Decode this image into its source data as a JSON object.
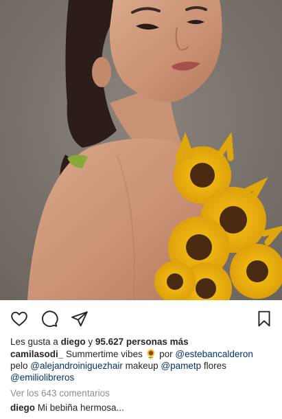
{
  "post": {
    "image_alt": "portrait with sunflowers",
    "likes": {
      "prefix": "Les gusta a ",
      "user": "diego",
      "middle": " y ",
      "count": "95.627 personas más"
    },
    "caption": {
      "username": "camilasodi_",
      "text_1": " Summertime vibes ",
      "emoji": "🌻",
      "text_2": " por ",
      "mention_1": "@estebancalderon",
      "text_3": "pelo ",
      "mention_2": "@alejandroiniguezhair",
      "text_4": " makeup ",
      "mention_3": "@pametp",
      "text_5": " flores",
      "mention_4": "@emiliolibreros"
    },
    "view_comments": "Ver los 643 comentarios",
    "comment": {
      "user": "diego",
      "text": " Mi bebiña hermosa..."
    }
  },
  "icons": {
    "like": "heart-icon",
    "comment": "comment-bubble-icon",
    "share": "paper-plane-icon",
    "save": "bookmark-icon"
  },
  "colors": {
    "text": "#262626",
    "mention": "#003569",
    "secondary": "#8e8e8e",
    "sunflower": "#f2b705"
  }
}
